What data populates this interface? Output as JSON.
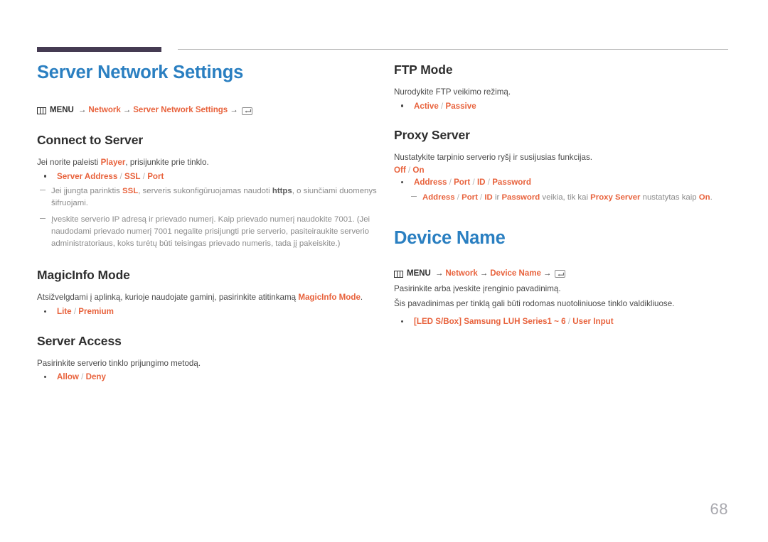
{
  "page": {
    "number": "68",
    "accent_blue": "#2a7fc1",
    "accent_orange": "#e8623c",
    "header_bar_color": "#453b52",
    "body_text_color": "#4a4a4a",
    "note_text_color": "#8a8a8a"
  },
  "icons": {
    "menu": "menu-grid-icon",
    "enter": "enter-key-icon",
    "arrow": "→"
  },
  "left_column": {
    "doc_title": "Server Network Settings",
    "menu_path": {
      "label": "MENU",
      "arrow1": "→",
      "item1": "Network",
      "arrow2": "→",
      "item2": "Server Network Settings",
      "arrow3": "→"
    },
    "sections": [
      {
        "title": "Connect to Server",
        "body_prefix": "Jei norite paleisti ",
        "body_highlight": "Player",
        "body_suffix": ", prisijunkite prie tinklo.",
        "options": [
          {
            "a": "Server Address",
            "b": "SSL",
            "c": "Port"
          }
        ],
        "note1": {
          "p1": "Jei įjungta parinktis ",
          "h1": "SSL",
          "p2": ", serveris sukonfigūruojamas naudoti ",
          "b1": "https",
          "p3": ", o siunčiami duomenys šifruojami."
        },
        "note2": "Įveskite serverio IP adresą ir prievado numerį. Kaip prievado numerį naudokite 7001. (Jei naudodami prievado numerį 7001 negalite prisijungti prie serverio, pasiteiraukite serverio administratoriaus, koks turėtų būti teisingas prievado numeris, tada jį pakeiskite.)"
      },
      {
        "title": "MagicInfo Mode",
        "body_prefix": "Atsižvelgdami į aplinką, kurioje naudojate gaminį, pasirinkite atitinkamą ",
        "body_highlight": "MagicInfo Mode",
        "body_suffix": ".",
        "options": [
          {
            "a": "Lite",
            "b": "Premium"
          }
        ]
      },
      {
        "title": "Server Access",
        "body": "Pasirinkite serverio tinklo prijungimo metodą.",
        "options": [
          {
            "a": "Allow",
            "b": "Deny"
          }
        ]
      }
    ]
  },
  "right_column": {
    "sections": [
      {
        "title": "FTP Mode",
        "body": "Nurodykite FTP veikimo režimą.",
        "options": [
          {
            "a": "Active",
            "b": "Passive"
          }
        ]
      },
      {
        "title": "Proxy Server",
        "body": "Nustatykite tarpinio serverio ryšį ir susijusias funkcijas.",
        "plain_options": {
          "a": "Off",
          "b": "On"
        },
        "options": [
          {
            "a": "Address",
            "b": "Port",
            "c": "ID",
            "d": "Password"
          }
        ],
        "note": {
          "a": "Address",
          "b": "Port",
          "c": "ID",
          "conj": " ir ",
          "d": "Password",
          "mid": " veikia, tik kai ",
          "e": "Proxy Server",
          "tail": " nustatytas kaip ",
          "f": "On",
          "end": "."
        }
      }
    ],
    "doc_title": "Device Name",
    "menu_path": {
      "label": "MENU",
      "arrow1": "→",
      "item1": "Network",
      "arrow2": "→",
      "item2": "Device Name",
      "arrow3": "→"
    },
    "device_body1": "Pasirinkite arba įveskite įrenginio pavadinimą.",
    "device_body2": "Šis pavadinimas per tinklą gali būti rodomas nuotoliniuose tinklo valdikliuose.",
    "device_options": [
      {
        "a": "[LED S/Box] Samsung LUH Series1 ~ 6",
        "b": "User Input"
      }
    ]
  }
}
